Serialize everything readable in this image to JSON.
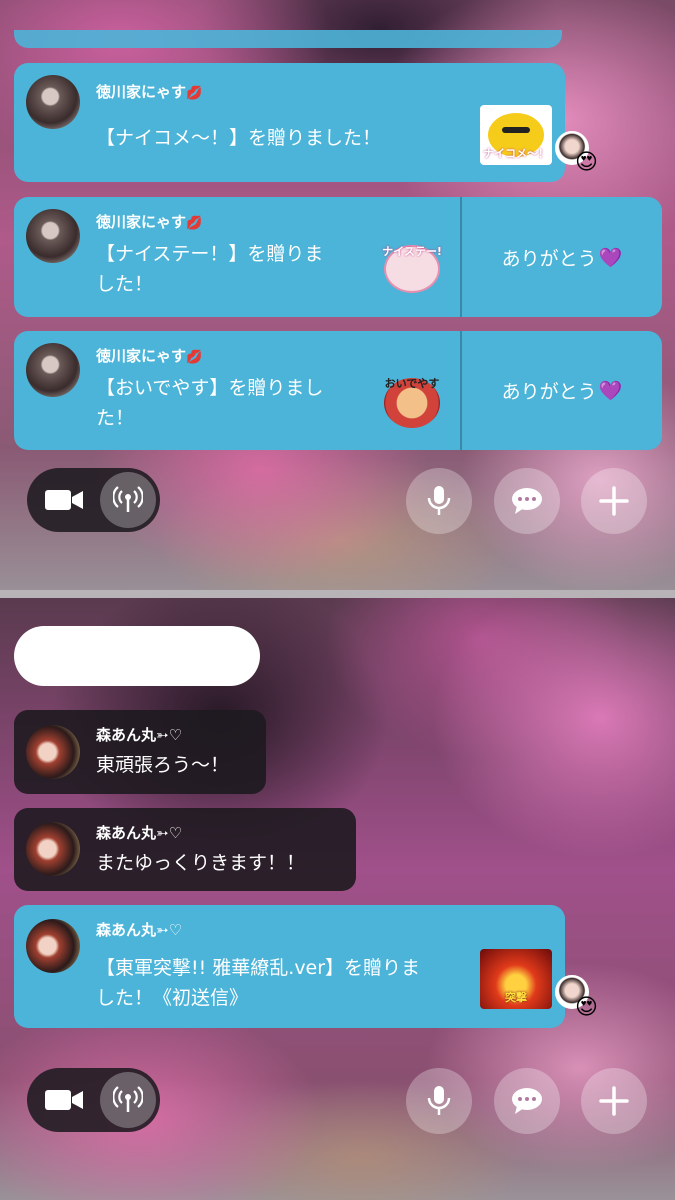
{
  "top": {
    "comments": [
      {
        "user": "徳川家にゃす",
        "user_icon": "lips-icon",
        "text": "【ナイコメ〜！】を贈りました！",
        "sticker_label": "ナイコメ〜！"
      },
      {
        "user": "徳川家にゃす",
        "user_icon": "lips-icon",
        "text_line1": "【ナイステー！】を贈りま",
        "text_line2": "した！",
        "sticker_label": "ナイステー!",
        "thanks": "ありがとう",
        "thanks_icon": "purple-heart-icon"
      },
      {
        "user": "徳川家にゃす",
        "user_icon": "lips-icon",
        "text_line1": "【おいでやす】を贈りまし",
        "text_line2": "た！",
        "sticker_label": "おいでやす",
        "thanks": "ありがとう",
        "thanks_icon": "purple-heart-icon"
      }
    ]
  },
  "bottom": {
    "comments": [
      {
        "user": "森あん丸➳♡",
        "text": "東頑張ろう〜！"
      },
      {
        "user": "森あん丸➳♡",
        "text": "またゆっくりきます！！"
      },
      {
        "user": "森あん丸➳♡",
        "text_line1": "【東軍突撃!! 雅華繚乱.ver】を贈りま",
        "text_line2": "した！《初送信》",
        "sticker_label": "突撃"
      }
    ]
  },
  "controls": {
    "camera_icon": "video-camera-icon",
    "live_icon": "broadcast-icon",
    "mic_icon": "microphone-icon",
    "chat_icon": "chat-bubble-icon",
    "add_icon": "plus-icon"
  },
  "colors": {
    "gift_bubble": "#4cb4d8",
    "comment_bubble": "#1e1a20",
    "heart": "#e0409a"
  }
}
